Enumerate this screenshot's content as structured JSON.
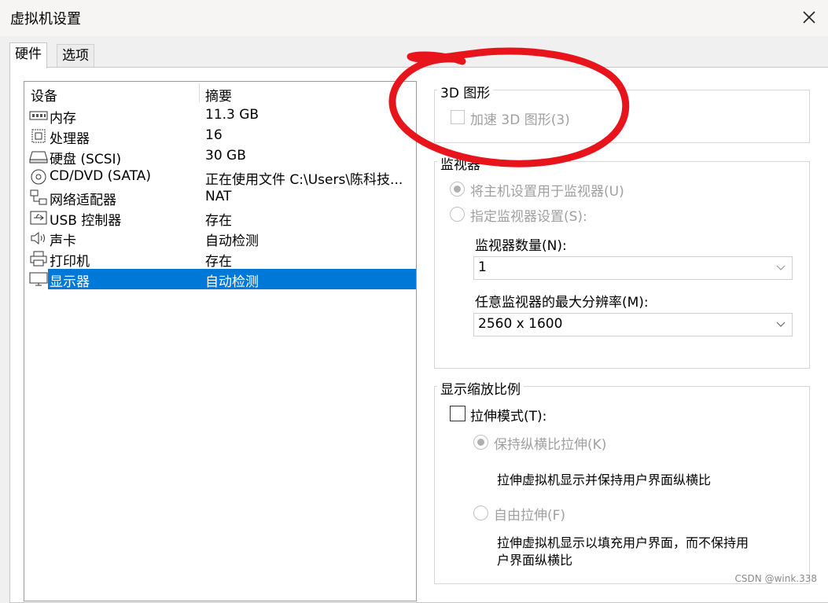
{
  "window": {
    "title": "虚拟机设置",
    "close_icon": "close-icon"
  },
  "tabs": [
    {
      "label": "硬件"
    },
    {
      "label": "选项"
    }
  ],
  "device_list": {
    "headers": {
      "device": "设备",
      "summary": "摘要"
    },
    "rows": [
      {
        "icon": "memory-icon",
        "name": "内存",
        "value": "11.3 GB"
      },
      {
        "icon": "processor-icon",
        "name": "处理器",
        "value": "16"
      },
      {
        "icon": "harddisk-icon",
        "name": "硬盘 (SCSI)",
        "value": "30 GB"
      },
      {
        "icon": "cd-icon",
        "name": "CD/DVD (SATA)",
        "value": "正在使用文件 C:\\Users\\陈科技..."
      },
      {
        "icon": "network-icon",
        "name": "网络适配器",
        "value": "NAT"
      },
      {
        "icon": "usb-icon",
        "name": "USB 控制器",
        "value": "存在"
      },
      {
        "icon": "sound-icon",
        "name": "声卡",
        "value": "自动检测"
      },
      {
        "icon": "printer-icon",
        "name": "打印机",
        "value": "存在"
      },
      {
        "icon": "display-icon",
        "name": "显示器",
        "value": "自动检测",
        "selected": true
      }
    ]
  },
  "graphics_3d": {
    "group_title": "3D 图形",
    "accelerate_label": "加速 3D 图形(3)",
    "accelerate_checked": false
  },
  "monitor": {
    "group_title": "监视器",
    "use_host_label": "将主机设置用于监视器(U)",
    "specify_label": "指定监视器设置(S):",
    "count_label": "监视器数量(N):",
    "count_value": "1",
    "max_res_label": "任意监视器的最大分辨率(M):",
    "max_res_value": "2560 x 1600"
  },
  "scaling": {
    "group_title": "显示缩放比例",
    "stretch_label": "拉伸模式(T):",
    "stretch_checked": false,
    "keep_aspect_label": "保持纵横比拉伸(K)",
    "keep_aspect_desc": "拉伸虚拟机显示并保持用户界面纵横比",
    "free_stretch_label": "自由拉伸(F)",
    "free_stretch_desc_line1": "拉伸虚拟机显示以填充用户界面，而不保持用",
    "free_stretch_desc_line2": "户界面纵横比"
  },
  "watermark": "CSDN @wink.338",
  "colors": {
    "selection": "#0078d7",
    "annotation": "#e8141c",
    "disabled_text": "#a0a0a0"
  }
}
